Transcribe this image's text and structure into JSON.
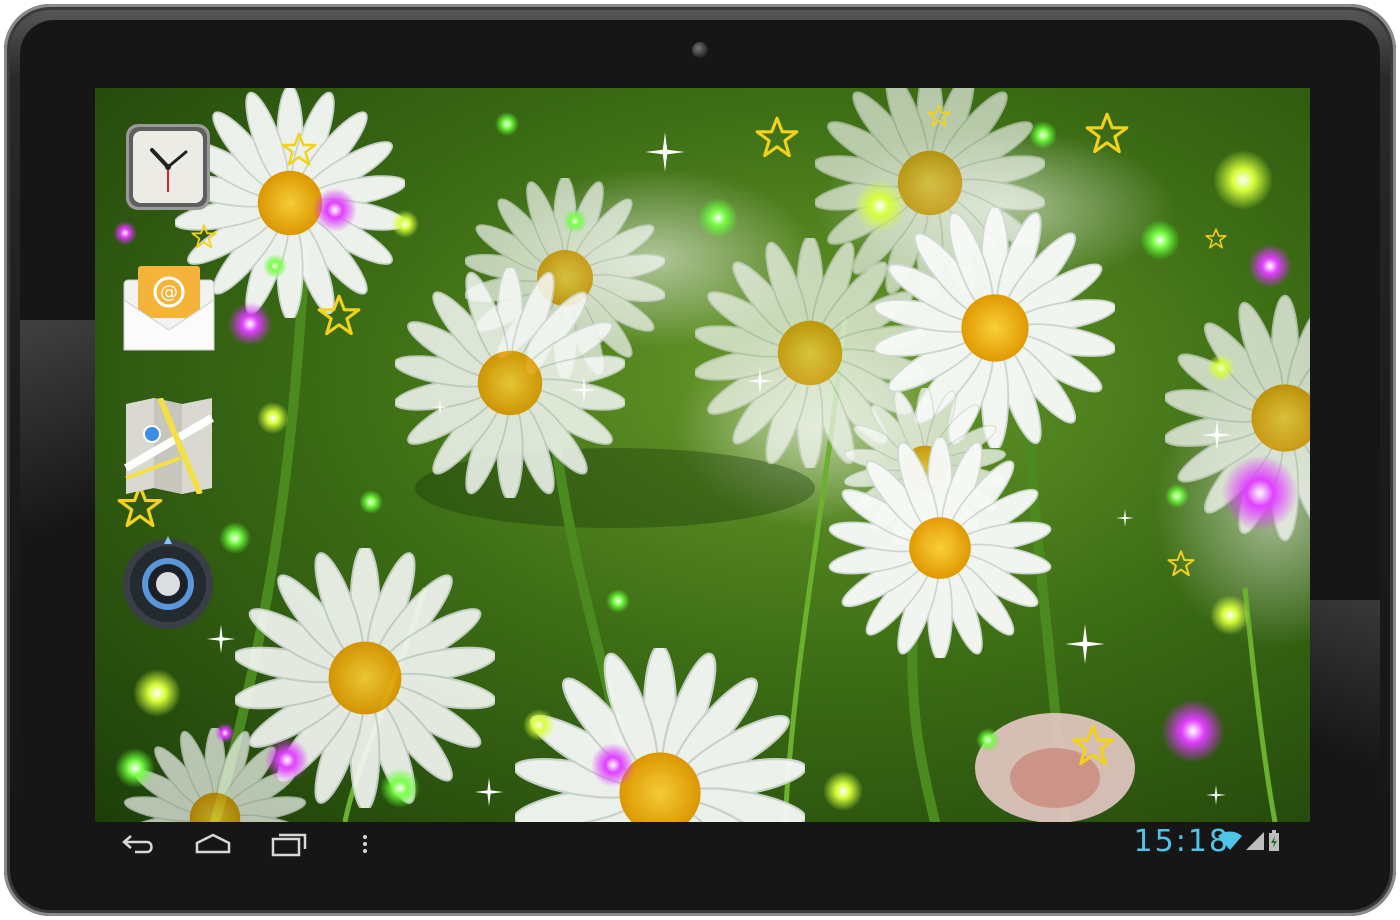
{
  "status_bar": {
    "time": "15:18"
  },
  "home_icons": [
    {
      "name": "clock-app-icon"
    },
    {
      "name": "email-app-icon",
      "glyph": "@"
    },
    {
      "name": "maps-app-icon"
    },
    {
      "name": "camera-app-icon"
    }
  ],
  "nav": {
    "back": "back-icon",
    "home": "home-icon",
    "recents": "recents-icon",
    "menu": "menu-icon"
  },
  "colors": {
    "clock_text": "#4fc3e8",
    "wifi": "#4fc3e8",
    "star": "#f2d21a"
  }
}
